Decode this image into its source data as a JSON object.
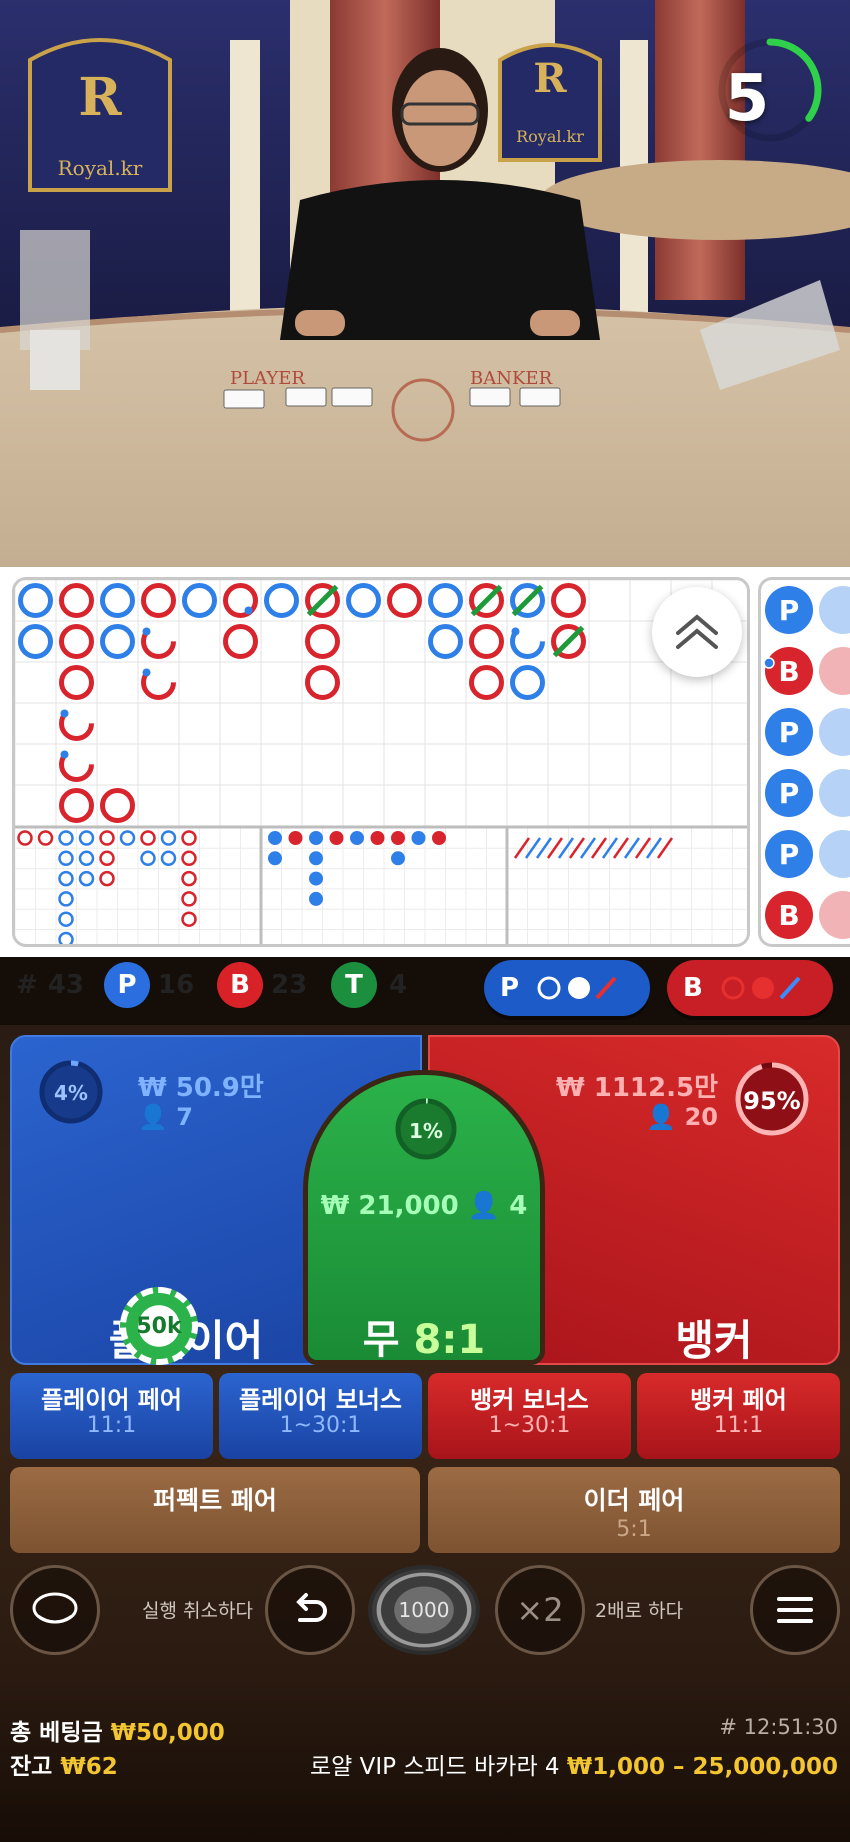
{
  "video": {
    "dealer_badge": "Royal.kr",
    "table_left": "PLAYER",
    "table_right": "BANKER",
    "logo_letter": "R",
    "logo_word": "Royal"
  },
  "timer": {
    "seconds": "5",
    "progress": 0.35
  },
  "stats": {
    "round_label": "#",
    "round": "43",
    "player_letter": "P",
    "player_count": "16",
    "banker_letter": "B",
    "banker_count": "23",
    "tie_letter": "T",
    "tie_count": "4"
  },
  "ask": {
    "player_letter": "P",
    "banker_letter": "B"
  },
  "bets": {
    "player": {
      "label": "플레이어",
      "percent": "4%",
      "percent_value": 4,
      "amount": "₩ 50.9만",
      "users": "7",
      "chip": "50k"
    },
    "tie": {
      "label": "무",
      "odds": "8:1",
      "percent": "1%",
      "percent_value": 1,
      "amount": "₩ 21,000",
      "users": "4"
    },
    "banker": {
      "label": "뱅커",
      "percent": "95%",
      "percent_value": 95,
      "amount": "₩ 1112.5만",
      "users": "20"
    }
  },
  "side_bets": [
    {
      "label": "플레이어 페어",
      "odds": "11:1"
    },
    {
      "label": "플레이어 보너스",
      "odds": "1~30:1"
    },
    {
      "label": "뱅커 보너스",
      "odds": "1~30:1"
    },
    {
      "label": "뱅커 페어",
      "odds": "11:1"
    }
  ],
  "pair_bets": [
    {
      "label": "퍼펙트 페어",
      "odds": ""
    },
    {
      "label": "이더 페어",
      "odds": "5:1"
    }
  ],
  "controls": {
    "undo_label": "실행 취소하다",
    "chip_value": "1000",
    "double_icon": "×2",
    "double_label": "2배로 하다"
  },
  "footer": {
    "total_label": "총 베팅금",
    "total": "₩50,000",
    "balance_label": "잔고",
    "balance": "₩62",
    "round_id": "# 12:51:30",
    "table_name": "로얄 VIP 스피드 바카라 4",
    "limits": "₩1,000 – 25,000,000"
  },
  "colors": {
    "player": "#1f5fd0",
    "banker": "#d01f26",
    "tie": "#17a23b",
    "gold": "#f2c531"
  },
  "big_road": [
    [
      {
        "c": "P"
      },
      {
        "c": "P"
      }
    ],
    [
      {
        "c": "B"
      },
      {
        "c": "B"
      },
      {
        "c": "B"
      },
      {
        "c": "B",
        "pp": 1
      },
      {
        "c": "B",
        "pp": 1
      },
      {
        "c": "B"
      }
    ],
    [
      {
        "c": "P"
      },
      {
        "c": "P"
      }
    ],
    [
      {
        "c": "B"
      },
      {
        "c": "B",
        "pp": 1
      },
      {
        "c": "B",
        "pp": 1
      }
    ],
    [
      {
        "c": "P"
      }
    ],
    [
      {
        "c": "B",
        "bp": 1
      },
      {
        "c": "B"
      }
    ],
    [
      {
        "c": "P"
      }
    ],
    [
      {
        "c": "B",
        "tie": 1
      },
      {
        "c": "B"
      },
      {
        "c": "B"
      }
    ],
    [
      {
        "c": "P"
      }
    ],
    [
      {
        "c": "B"
      }
    ],
    [
      {
        "c": "P"
      },
      {
        "c": "P"
      }
    ],
    [
      {
        "c": "B",
        "tie": 1
      },
      {
        "c": "B"
      },
      {
        "c": "B"
      }
    ],
    [
      {
        "c": "P",
        "tie": 1
      },
      {
        "c": "P",
        "pp": 1
      },
      {
        "c": "P"
      }
    ],
    [
      {
        "c": "B"
      },
      {
        "c": "B",
        "tie": 1
      }
    ]
  ],
  "big_road_tail": [
    {
      "c": "B",
      "col": 2,
      "row": 5
    }
  ],
  "big_eye": [
    [
      "B"
    ],
    [
      "B"
    ],
    [
      "P",
      "P",
      "P",
      "P",
      "P",
      "P"
    ],
    [
      "P",
      "P",
      "P"
    ],
    [
      "B",
      "B",
      "B"
    ],
    [
      "P"
    ],
    [
      "B",
      "P"
    ],
    [
      "P",
      "P"
    ],
    [
      "B",
      "B",
      "B",
      "B",
      "B"
    ]
  ],
  "small_road": [
    [
      "P",
      "P"
    ],
    [
      "B"
    ],
    [
      "P",
      "P",
      "P",
      "P"
    ],
    [
      "B"
    ],
    [
      "P"
    ],
    [
      "B"
    ],
    [
      "B",
      "P"
    ],
    [
      "P"
    ],
    [
      "B"
    ]
  ],
  "cockroach": [
    "R",
    "B",
    "B",
    "R",
    "B",
    "R",
    "B",
    "R",
    "B",
    "R",
    "B",
    "R",
    "B",
    "R"
  ],
  "side_road": [
    {
      "c": "P"
    },
    {
      "c": "B",
      "pp": 1
    },
    {
      "c": "P"
    },
    {
      "c": "P"
    },
    {
      "c": "P"
    },
    {
      "c": "B"
    }
  ]
}
